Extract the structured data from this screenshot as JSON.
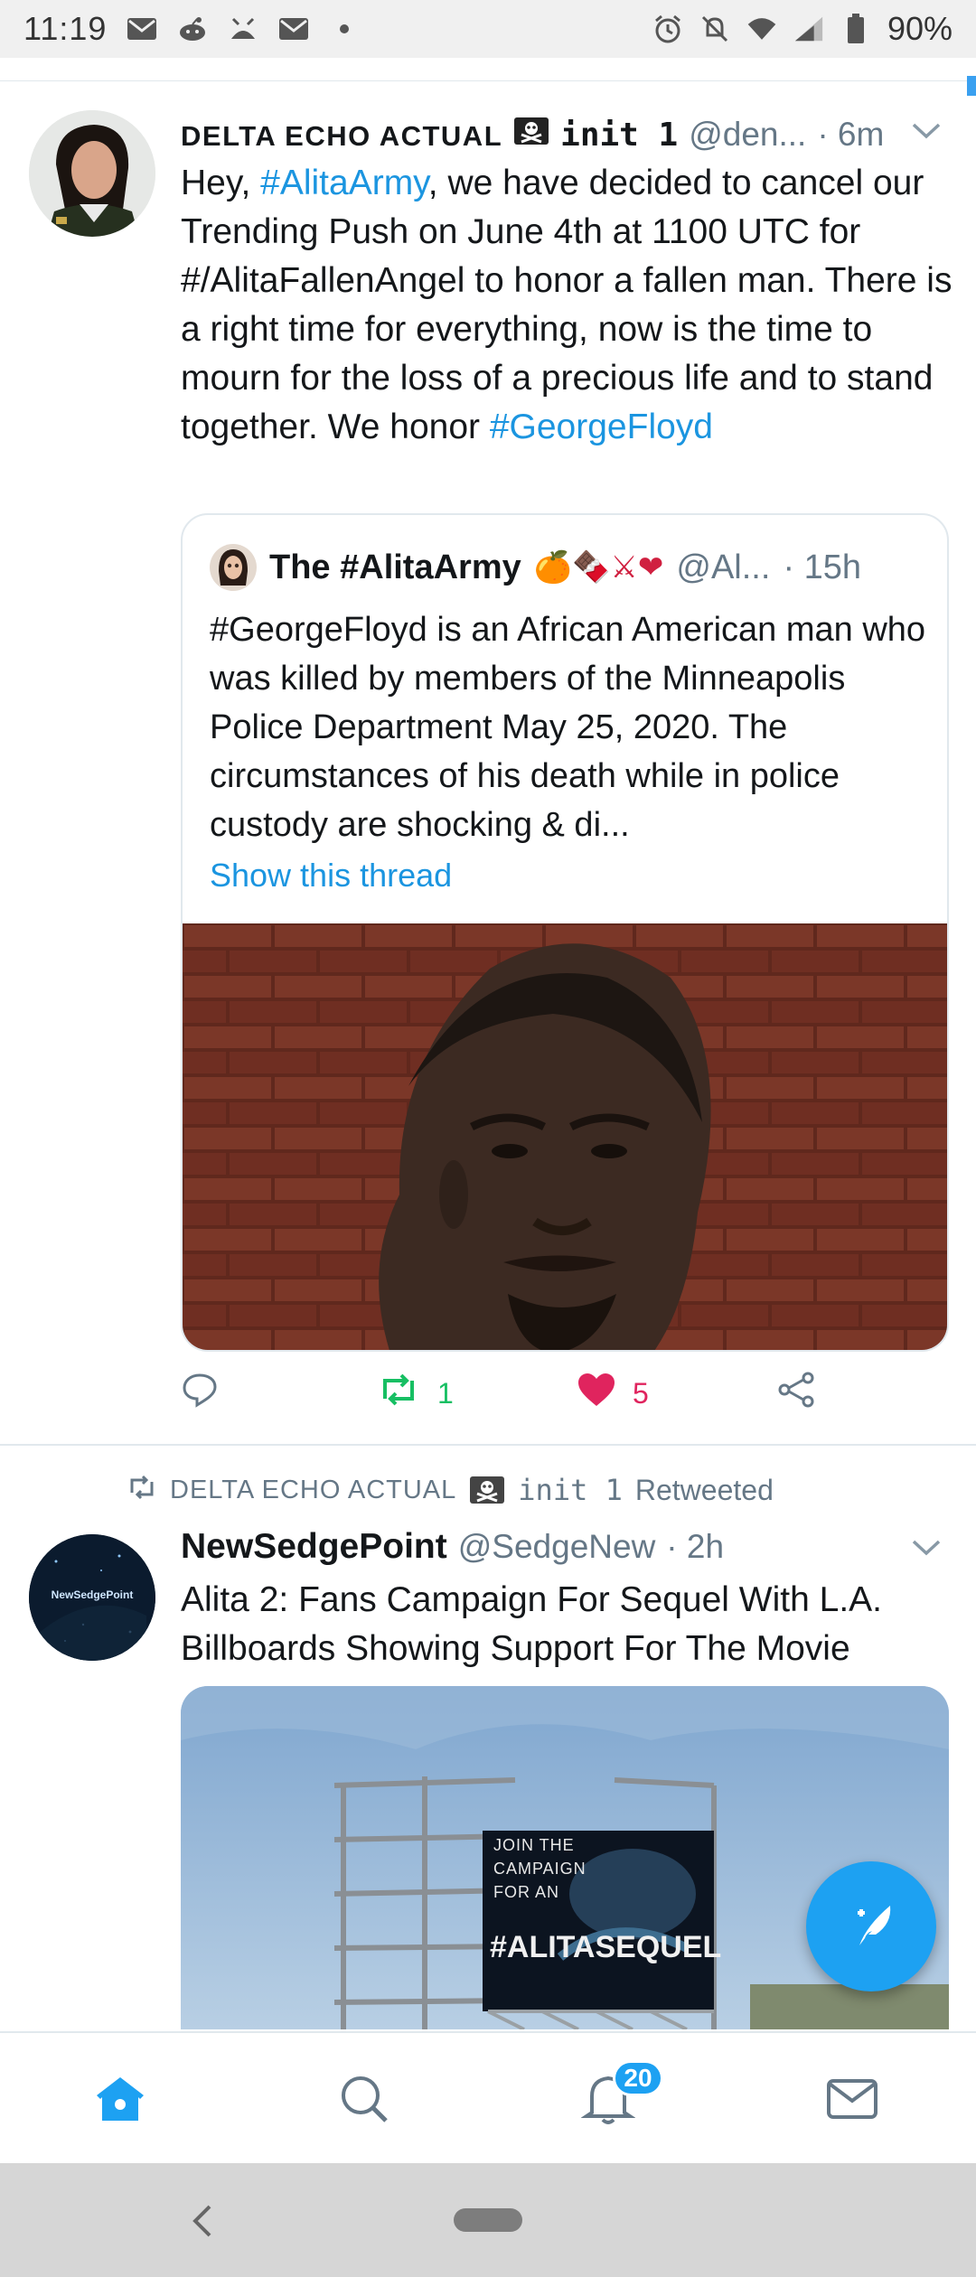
{
  "status_bar": {
    "time": "11:19",
    "left_icons": [
      "gmail-icon",
      "reddit-icon",
      "alien-icon",
      "gmail-icon",
      "dot-icon"
    ],
    "right_icons": [
      "alarm-icon",
      "mute-icon",
      "wifi-icon",
      "signal-icon",
      "battery-icon"
    ],
    "battery": "90%"
  },
  "tweet1": {
    "author_name": "DELTA ECHO ACTUAL",
    "author_suffix": "init 1",
    "handle": "@den...",
    "time": "· 6m",
    "text_pre": "Hey, ",
    "link1": "#AlitaArmy",
    "text_mid": ", we have decided to cancel our Trending Push on June 4th at 1100 UTC for #/AlitaFallenAngel to honor a fallen man. There is a right time for everything, now is the time to mourn for the loss of a precious life and to stand together. We honor ",
    "link2": "#GeorgeFloyd",
    "quote": {
      "author_name": "The #AlitaArmy",
      "author_emojis": "🍊🍫⚔❤",
      "handle": "@Al...",
      "time": "· 15h",
      "text": "#GeorgeFloyd is an African American man who was killed by members of the Minneapolis Police Department May 25, 2020. The circumstances of his death while in police custody are shocking & di...",
      "show_thread": "Show this thread"
    },
    "actions": {
      "reply_count": "",
      "retweet_count": "1",
      "like_count": "5"
    },
    "colors": {
      "retweet": "#17bf63",
      "like": "#e0245e"
    }
  },
  "tweet2": {
    "retweeted_by_name": "DELTA ECHO ACTUAL",
    "retweeted_by_suffix": "init 1",
    "retweeted_label": "Retweeted",
    "avatar_text": "NewSedgePoint",
    "author_name": "NewSedgePoint",
    "handle": "@SedgeNew",
    "time": "· 2h",
    "text": "Alita 2: Fans Campaign For Sequel With L.A. Billboards Showing Support For The Movie",
    "billboard": {
      "line1": "JOIN THE",
      "line2": "CAMPAIGN",
      "line3": "FOR AN",
      "hashtag": "#ALITASEQUEL"
    }
  },
  "bottom_nav": {
    "items": [
      "home-icon",
      "search-icon",
      "notifications-icon",
      "messages-icon"
    ],
    "notifications_badge": "20",
    "active": "home-icon"
  },
  "accent_color": "#1da1f2"
}
